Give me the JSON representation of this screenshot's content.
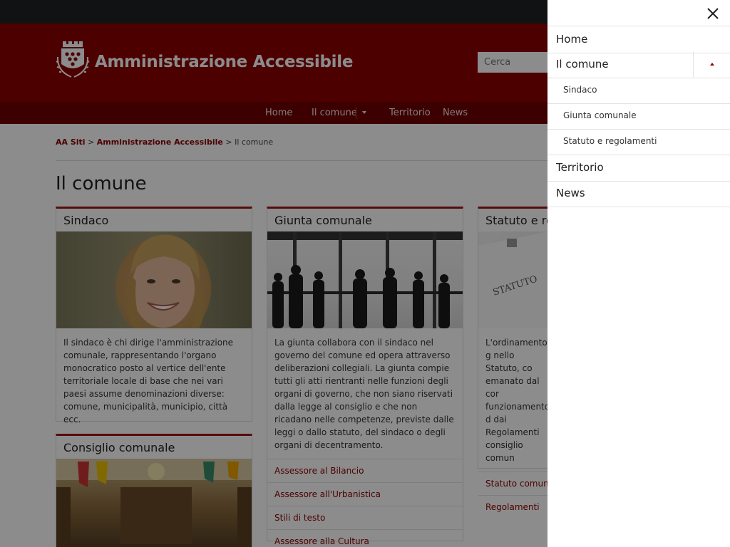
{
  "site": {
    "title": "Amministrazione Accessibile",
    "search_placeholder": "Cerca"
  },
  "nav": {
    "home": "Home",
    "comune": "Il comune",
    "territorio": "Territorio",
    "news": "News"
  },
  "breadcrumb": {
    "root": "AA Siti",
    "sep": " > ",
    "section": "Amministrazione Accessibile",
    "current": "Il comune"
  },
  "page_title": "Il comune",
  "cards": {
    "sindaco": {
      "title": "Sindaco",
      "text": "Il sindaco è chi dirige l'amministrazione comunale, rappresentando l'organo monocratico posto al vertice dell'ente territoriale locale di base che nei vari paesi assume denominazioni diverse: comune, municipalità, municipio, città ecc."
    },
    "giunta": {
      "title": "Giunta comunale",
      "text": "La giunta collabora con il sindaco nel governo del comune ed opera attraverso deliberazioni collegiali. La giunta compie tutti gli atti rientranti nelle funzioni degli organi di governo, che non siano riservati dalla legge al consiglio e che non ricadano nelle competenze, previste dalle leggi o dallo statuto, del sindaco o degli organi di decentramento.",
      "links": [
        "Assessore al Bilancio",
        "Assessore all'Urbanistica",
        "Stili di testo",
        "Assessore alla Cultura"
      ]
    },
    "statuto": {
      "title": "Statuto e reg",
      "text": "L'ordinamento g nello Statuto, co emanato dal cor funzionamento d dai Regolamenti consiglio comun",
      "links": [
        "Statuto comuna",
        "Regolamenti"
      ]
    },
    "consiglio": {
      "title": "Consiglio comunale"
    }
  },
  "drawer": {
    "items": [
      "Home",
      "Il comune",
      "Sindaco",
      "Giunta comunale",
      "Statuto e regolamenti",
      "Territorio",
      "News"
    ]
  },
  "colors": {
    "brand": "#8b0000",
    "nav": "#6f0000",
    "topbar": "#1e2226",
    "accent": "#a31515"
  },
  "icons": {
    "close": "close-icon",
    "expand": "chevron-up-icon",
    "logo": "castle-logo-icon"
  }
}
